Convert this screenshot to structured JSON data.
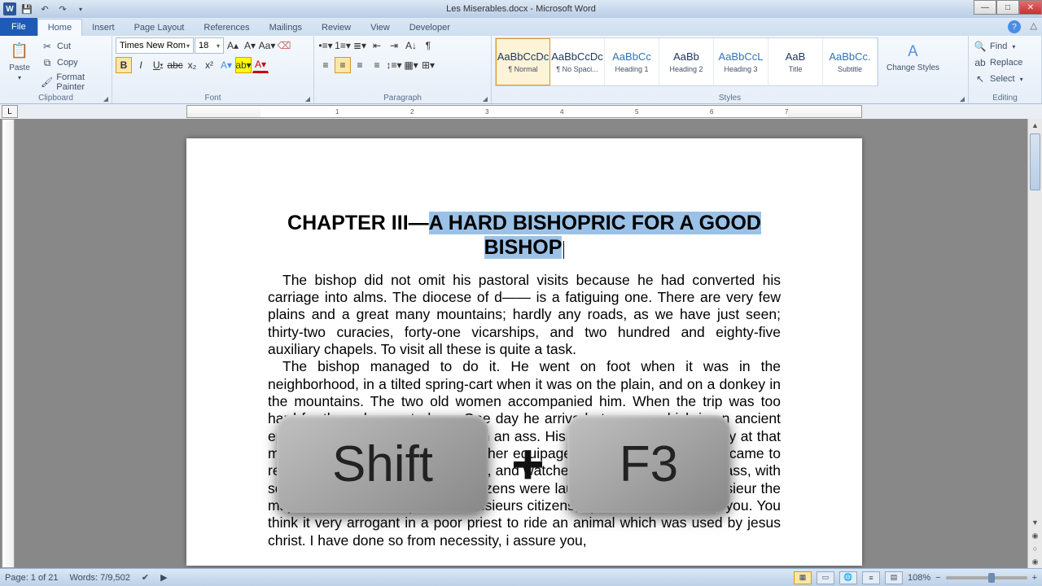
{
  "app": {
    "title": "Les Miserables.docx - Microsoft Word"
  },
  "tabs": {
    "file": "File",
    "items": [
      "Home",
      "Insert",
      "Page Layout",
      "References",
      "Mailings",
      "Review",
      "View",
      "Developer"
    ],
    "active": 0
  },
  "clipboard": {
    "paste": "Paste",
    "cut": "Cut",
    "copy": "Copy",
    "format_painter": "Format Painter",
    "label": "Clipboard"
  },
  "font": {
    "name": "Times New Rom",
    "size": "18",
    "label": "Font"
  },
  "paragraph": {
    "label": "Paragraph"
  },
  "styles": {
    "label": "Styles",
    "items": [
      {
        "preview": "AaBbCcDc",
        "name": "¶ Normal",
        "sel": true,
        "cls": ""
      },
      {
        "preview": "AaBbCcDc",
        "name": "¶ No Spaci...",
        "sel": false,
        "cls": ""
      },
      {
        "preview": "AaBbCc",
        "name": "Heading 1",
        "sel": false,
        "cls": "blue"
      },
      {
        "preview": "AaBb",
        "name": "Heading 2",
        "sel": false,
        "cls": ""
      },
      {
        "preview": "AaBbCcL",
        "name": "Heading 3",
        "sel": false,
        "cls": "blue"
      },
      {
        "preview": "AaB",
        "name": "Title",
        "sel": false,
        "cls": ""
      },
      {
        "preview": "AaBbCc.",
        "name": "Subtitle",
        "sel": false,
        "cls": "blue"
      }
    ],
    "change_styles": "Change Styles"
  },
  "editing": {
    "label": "Editing",
    "find": "Find",
    "replace": "Replace",
    "select": "Select"
  },
  "document": {
    "title_pre": "CHAPTER III—",
    "title_sel": "A HARD BISHOPRIC FOR A GOOD BISHOP",
    "p1": "The bishop did not omit his pastoral visits because he had converted his carriage into alms. The diocese of d—— is a fatiguing one. There are very few plains and a great many mountains; hardly any roads, as we have just seen; thirty-two curacies, forty-one vicarships, and two hundred and eighty-five auxiliary chapels. To visit all these is quite a task.",
    "p2a": "The bishop managed to do it. He went on foot when it was in the neighborhood, in a tilted spring-cart when it was on the plain, and on a donkey in the mountains. The two old women accompanied him. When the trip was too hard for them, he went alone. One day he arrived at senez, which is an ancient episcopal city. He was mounted on an ass. His purse, which was very dry at that moment, did not permit him any other equipage. The mayor of the town came to receive him at the gate of the town, and watched him dismount from his ass, with scandalized eyes. Some of the citizens were laughing around him. \"monsieur the mayor,\" said the bishop, \"and messieurs citizens, i perceive that i shock you. You think it very arrogant in a poor priest to ride an animal which was used by jesus christ. I have done so from necessity, i assure you,"
  },
  "keys": {
    "k1": "Shift",
    "plus": "+",
    "k2": "F3"
  },
  "status": {
    "page": "Page: 1 of 21",
    "words": "Words: 7/9,502",
    "zoom": "108%"
  }
}
